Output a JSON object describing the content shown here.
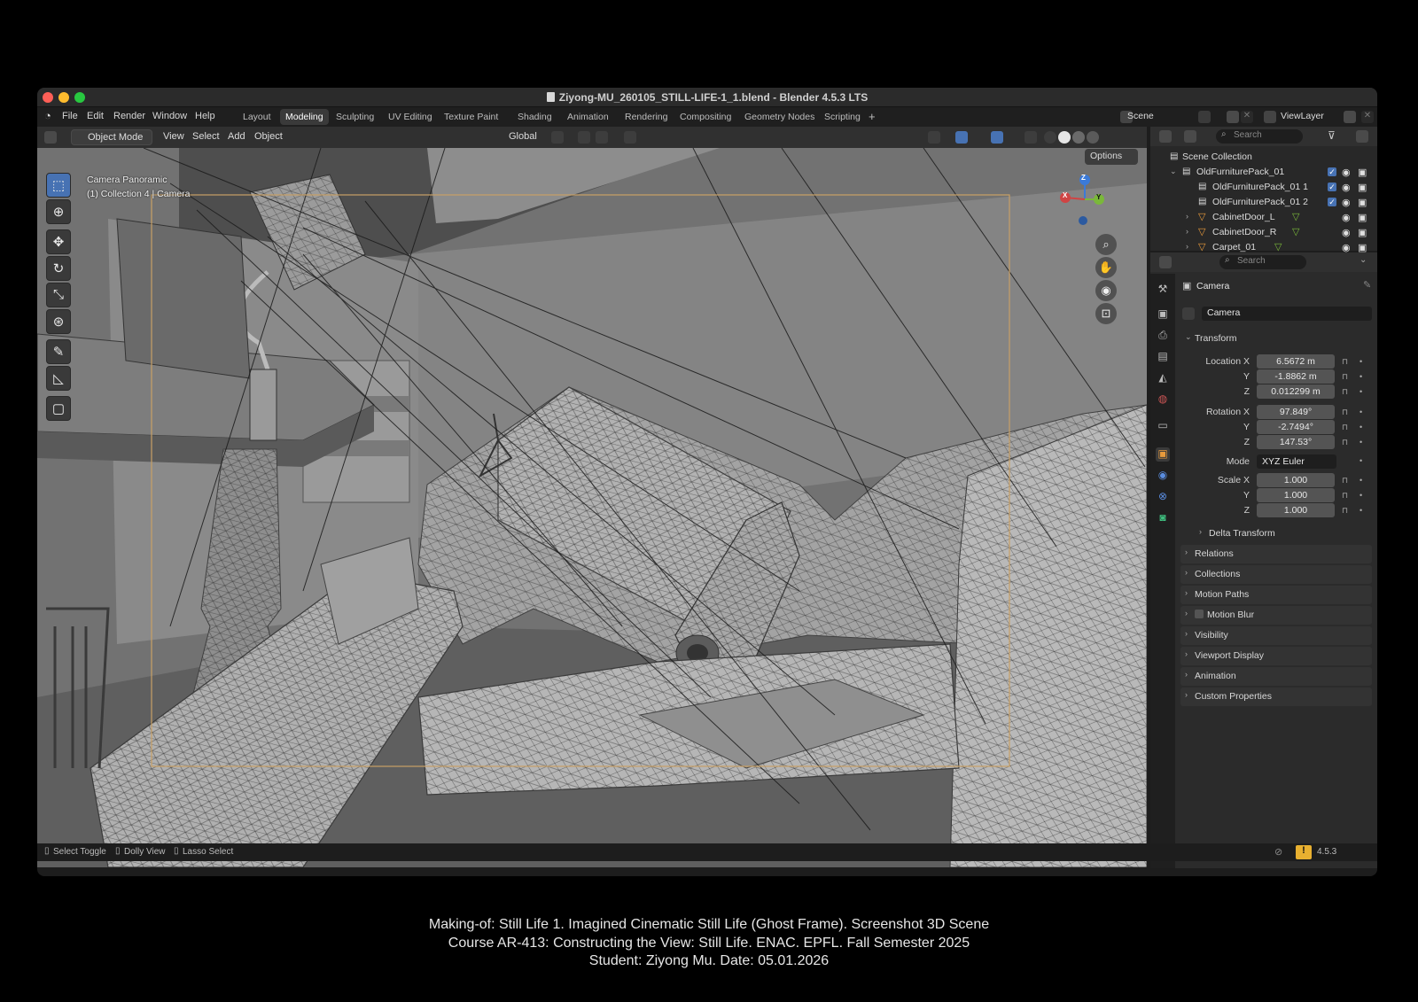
{
  "window": {
    "title": "Ziyong-MU_260105_STILL-LIFE-1_1.blend - Blender 4.5.3 LTS"
  },
  "menu": [
    "File",
    "Edit",
    "Render",
    "Window",
    "Help"
  ],
  "workspaces": [
    "Layout",
    "Modeling",
    "Sculpting",
    "UV Editing",
    "Texture Paint",
    "Shading",
    "Animation",
    "Rendering",
    "Compositing",
    "Geometry Nodes",
    "Scripting"
  ],
  "active_workspace": "Modeling",
  "scene_selector": "Scene",
  "view_layer": "ViewLayer",
  "viewport_header": {
    "mode": "Object Mode",
    "menus": [
      "View",
      "Select",
      "Add",
      "Object"
    ],
    "orientation": "Global",
    "options": "Options"
  },
  "viewport": {
    "overlay_line1": "Camera Panoramic",
    "overlay_line2": "(1) Collection 4 | Camera",
    "gizmo": {
      "x": "X",
      "y": "Y",
      "z": "Z"
    }
  },
  "outliner": {
    "search_placeholder": "Search",
    "items": [
      {
        "label": "Scene Collection"
      },
      {
        "label": "OldFurniturePack_01"
      },
      {
        "label": "OldFurniturePack_01 1"
      },
      {
        "label": "OldFurniturePack_01 2"
      },
      {
        "label": "CabinetDoor_L"
      },
      {
        "label": "CabinetDoor_R"
      },
      {
        "label": "Carpet_01"
      }
    ]
  },
  "properties": {
    "search_placeholder": "Search",
    "object_name": "Camera",
    "data_name": "Camera",
    "transform_label": "Transform",
    "location_label": "Location X",
    "rotation_label": "Rotation X",
    "scale_label": "Scale X",
    "axis_y": "Y",
    "axis_z": "Z",
    "location": {
      "x": "6.5672 m",
      "y": "-1.8862 m",
      "z": "0.012299 m"
    },
    "rotation": {
      "x": "97.849°",
      "y": "-2.7494°",
      "z": "147.53°"
    },
    "mode_label": "Mode",
    "mode_value": "XYZ Euler",
    "scale": {
      "x": "1.000",
      "y": "1.000",
      "z": "1.000"
    },
    "delta_transform": "Delta Transform",
    "panels": [
      "Relations",
      "Collections",
      "Motion Paths",
      "Motion Blur",
      "Visibility",
      "Viewport Display",
      "Animation",
      "Custom Properties"
    ]
  },
  "statusbar": {
    "hint1": "Select Toggle",
    "hint2": "Dolly View",
    "hint3": "Lasso Select",
    "version": "4.5.3"
  },
  "caption": {
    "line1": "Making-of: Still Life 1. Imagined Cinematic Still Life (Ghost Frame). Screenshot 3D Scene",
    "line2": "Course AR-413: Constructing the View: Still Life. ENAC. EPFL. Fall Semester 2025",
    "line3": "Student: Ziyong Mu. Date: 05.01.2026"
  },
  "colors": {
    "accent": "#4772b3",
    "camera_frame": "#c8a066",
    "window_bg": "#1d1d1d"
  }
}
